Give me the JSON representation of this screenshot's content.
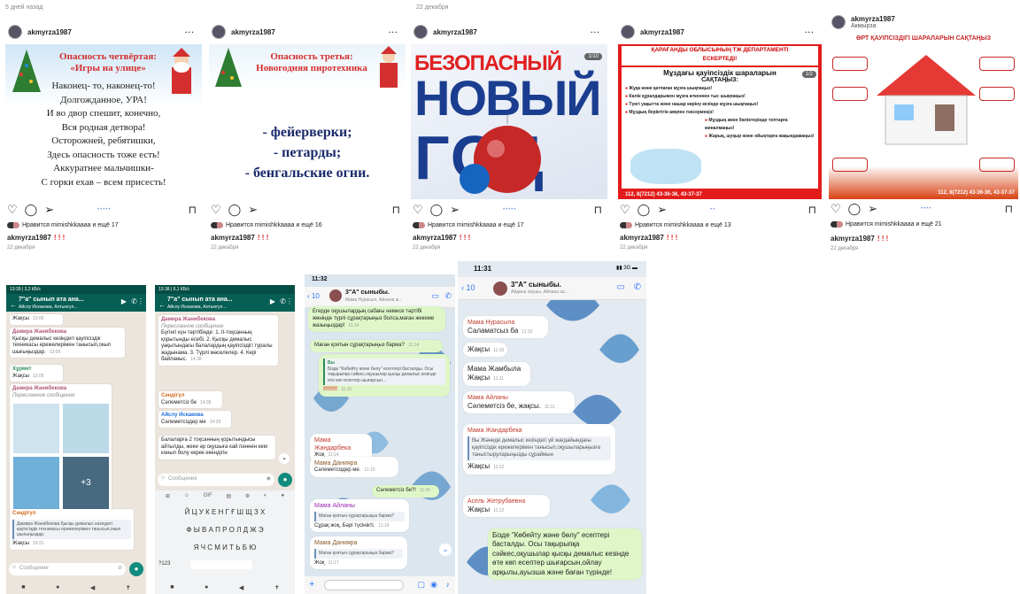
{
  "top_captions": {
    "left": "5 дней назад",
    "mid": "22 декабря"
  },
  "ig_posts": [
    {
      "user": "akmyrza1987",
      "likes": "Нравится mimishkkaaaa и ещё 17",
      "caption_user": "akmyrza1987",
      "marks": "! ! !",
      "date": "22 декабря",
      "poem_title": "Опасность четвёртая:",
      "poem_subtitle": "«Игры на улице»",
      "poem_lines": [
        "Наконец- то, наконец-то!",
        "Долгожданное, УРА!",
        "И во двор спешит, конечно,",
        "Вся родная детвора!",
        "Осторожней, ребятишки,",
        "Здесь опасность тоже есть!",
        "Аккуратнее мальчишки-",
        "С горки ехав – всем присесть!"
      ]
    },
    {
      "user": "akmyrza1987",
      "likes": "Нравится mimishkkaaaa и ещё 16",
      "caption_user": "akmyrza1987",
      "marks": "! ! !",
      "date": "22 декабря",
      "poem_title": "Опасность третья:",
      "poem_subtitle": "Новогодняя пиротехника",
      "poem_lines": [
        "- фейерверки;",
        "- петарды;",
        "- бенгальские огни."
      ]
    },
    {
      "user": "akmyrza1987",
      "likes": "Нравится mimishkkaaaa и ещё 17",
      "caption_user": "akmyrza1987",
      "marks": "! ! !",
      "date": "22 декабря",
      "badge": "1/10",
      "poster_line1": "БЕЗОПАСНЫЙ",
      "poster_line2": "НОВЫЙ",
      "poster_line3": "ГОД"
    },
    {
      "user": "akmyrza1987",
      "likes": "Нравится mimishkkaaaa и ещё 13",
      "caption_user": "akmyrza1987",
      "marks": "! ! !",
      "date": "22 декабря",
      "badge": "1/2",
      "header1": "ҚАРАҒАНДЫ ОБЛЫСЫНЫҢ ТЖ ДЕПАРТАМЕНТІ",
      "header2": "ЕСКЕРТЕДІ!",
      "title1": "Мұздағы қауіпсіздік шараларын",
      "title2": "САҚТАҢЫЗ:",
      "rules": [
        "Жұқа және қатпаған мұзға шықпаңыз!",
        "Көлік құралдарымен мұзға өткеннен тыс шықпаңыз!",
        "Түнгі уақытта және нашар көрінү кезінде мұзға шықпаңыз!",
        "Мұздың беріктігін аяқпен тексермеңіз!",
        "Мұздың жеке бөліктерінде топтарға жиналмаңыз!",
        "Жарық, шуқыр және ойықтарға жақындамаңыз!"
      ],
      "footer": "112, 8(7212) 43-36-36, 43-37-37"
    },
    {
      "user": "akmyrza1987",
      "sub": "Акмырза",
      "likes": "Нравится mimishkkaaaa и ещё 21",
      "caption_user": "akmyrza1987",
      "marks": "! ! !",
      "date": "22 декабря",
      "title": "ӨРТ ҚАУІПСІЗДІГІ ШАРАЛАРЫН САҚТАҢЫЗ",
      "footer": "112, 8(7212) 43-36-36, 43-37-37"
    }
  ],
  "chat1": {
    "status": "13:39 | 3,2 КБ/с",
    "name": "7\"а\" сынып ата ана...",
    "members": "Айслу Исканова, Алтынгул...",
    "messages": [
      {
        "text": "Жақсы",
        "time": "13:00"
      },
      {
        "name": "Дамира Жанибекова",
        "text": "Қысқы демалыс кезіндегі қауіпсіздік техникасы ережелерімен танысып,окып шығыңыздар.",
        "time": "13:09"
      },
      {
        "name": "Хұрмет",
        "text": "Жақсы",
        "time": "13:09"
      },
      {
        "name": "Дамира Жанибекова",
        "text": "Пересланное сообщение",
        "time": ""
      },
      {
        "name": "Сәндігүл",
        "quote": "Дамира Жанибекова Қысқы демалыс кезіндегі қауіпсіздік техникасы ережелерімен танысып,окып шығыңыздар.",
        "text": "Жақсы",
        "time": "19:21"
      }
    ],
    "more": "+3",
    "input_placeholder": "Сообщение"
  },
  "chat2": {
    "status": "13:38 | 6,1 КБ/с",
    "name": "7\"а\" сынып ата ана...",
    "members": "Айслу Исканова, Алтынгул...",
    "messages": [
      {
        "name": "Дамира Жанибекова",
        "fwd": "Пересланное сообщение",
        "text": "Бүгінгі күн тәртібінде: 1. II-тоқсанның қорытынды есебі. 2. Қысқы демалыс уақытындағы балалардың қауіпсіздігі туралы жадынама. 3. Түрлі мәселелер. 4. Кері байланыс.",
        "time": "14:38"
      },
      {
        "name": "Сәндігүл",
        "text": "Сәлеметсіз бе",
        "time": "14:38"
      },
      {
        "name": "Айслу Искакова",
        "text": "Сәлеметсіздер ме",
        "time": "14:39"
      },
      {
        "name": "",
        "text": "Балаларға 2 тоқсанның қорытындысы айтылды, жеке әр оқушыға кай пәннен кем конып болу керек екендігін",
        "time": ""
      }
    ],
    "input_placeholder": "Сообщение",
    "keyboard_rows": [
      "Й Ц У К Е Н Г Ғ Ш Щ З Х",
      "Ф Ы В А П Р О Л Д Ж Э",
      "Я Ч С М И Т Ь Б Ю"
    ],
    "keyboard_bottom": "?123"
  },
  "chat3": {
    "time": "11:32",
    "back": "10",
    "name": "3\"А\" сыныбы.",
    "members": "Мама Нурасыл, Айлана ж...",
    "messages": [
      {
        "text": "Егерде оқушылардың сабағы немесе тәртібі жөнінде түрлі сұрақтарыңыз болса,маған жекеме жазыңыздар!",
        "time": "11:14"
      },
      {
        "text": "Маған қоятын сұрақтарыңыз барма?",
        "time": "11:14"
      },
      {
        "name": "Вы",
        "quote": "Бізде \"Көбейту және бөлу\" есептері басталды. Осы тақырыпқа сәйкес,оқушылар қысқы демалыс кезінде өте көп есептер шығарсын...",
        "text": "!!!!!!!!",
        "time": "11:15"
      },
      {
        "name": "Мама Жандарбека",
        "text": "Жоқ",
        "time": "11:14"
      },
      {
        "name": "Мама Данияра",
        "text": "Сәлеметсіздер ме.",
        "time": "11:15"
      },
      {
        "text": "Сәлеметсіз бе?!",
        "time": "11:16"
      },
      {
        "name": "Мама Айланы",
        "quote": "Маған қоятын сұрақтарыңыз барма?",
        "text": "Сұрақ жоқ, Бәрі түсінікті.",
        "time": "11:16"
      },
      {
        "name": "Мама Данияра",
        "quote": "Маған қоятын сұрақтарыңыз барма?",
        "text": "Жоқ",
        "time": "11:17"
      }
    ]
  },
  "chat4": {
    "time": "11:31",
    "back": "10",
    "name": "3\"А\" сыныбы.",
    "members": "Айдана окушы, Айлана за...",
    "messages": [
      {
        "name": "Мама Нурасыла",
        "text": "Саламатсыз ба",
        "time": "11:10"
      },
      {
        "text": "Жақсы",
        "time": "11:10"
      },
      {
        "name": "Мама Жамбыла",
        "text": "Жақсы",
        "time": "11:11"
      },
      {
        "name": "Мама Айланы",
        "text": "Сәлеметсіз бе, жақсы.",
        "time": "11:11"
      },
      {
        "name": "Мама Жандарбека",
        "quote": "Вы Жәнеде демалыс кезіндегі үй жағдайындағы қауіпсіздік ережелерімен танысып,оқушыларыңызға таныстыруларыңызды сұраймын",
        "text": "Жақсы",
        "time": "11:12"
      },
      {
        "name": "Асель Жетрубаевна",
        "text": "Жақсы",
        "time": "11:12"
      },
      {
        "text": "Бізде \"Көбейту және бөлу\" есептері басталды. Осы тақырыпқа сәйкес,оқушылар қысқы демалыс кезінде өте көп есептер шығарсын,ойлау арқылы,ауызша және баған түрінде!",
        "time": ""
      }
    ]
  },
  "colors": {
    "wa_green": "#075e54",
    "wa_teal": "#128c7e",
    "ios_blue": "#3478f6",
    "ig_red": "#e0282e",
    "poster_blue": "#1a3d8f"
  }
}
